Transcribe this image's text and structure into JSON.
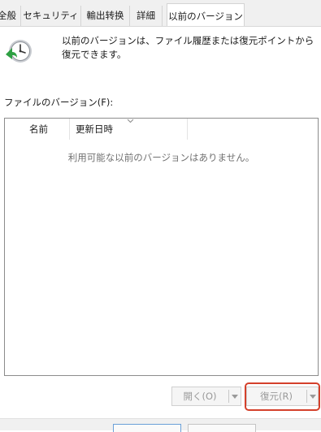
{
  "tabs": [
    {
      "label": "全般",
      "active": false
    },
    {
      "label": "セキュリティ",
      "active": false
    },
    {
      "label": "輸出转换",
      "active": false
    },
    {
      "label": "詳細",
      "active": false
    },
    {
      "label": "以前のバージョン",
      "active": true
    }
  ],
  "header": {
    "icon": "restore-clock-icon",
    "description": "以前のバージョンは、ファイル履歴または復元ポイントから復元できます。"
  },
  "versions": {
    "section_label": "ファイルのバージョン(F):",
    "columns": [
      "名前",
      "更新日時"
    ],
    "empty_message": "利用可能な以前のバージョンはありません。"
  },
  "buttons": {
    "open": "開く(O)",
    "restore": "復元(R)"
  },
  "colors": {
    "highlight": "#d4402b",
    "tabstrip": "#f0f0f0"
  }
}
